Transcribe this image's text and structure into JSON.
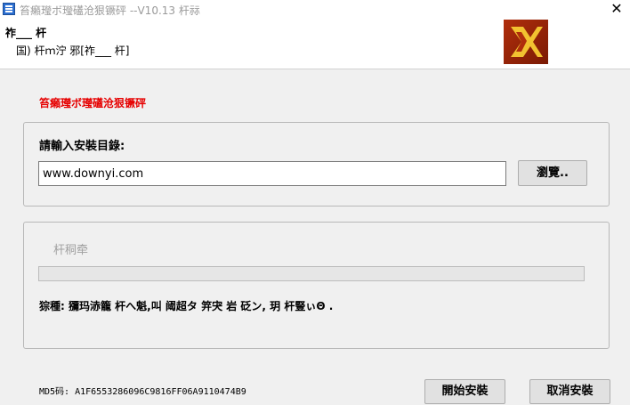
{
  "window": {
    "title": "笞癩㼆ボ㼆礚沧狠镢砰  --V10.13  杆祘",
    "close_label": "✕"
  },
  "header": {
    "title": "祚___  杆",
    "subtitle": "国)   杆ｍ泞     邪[祚___  杆]"
  },
  "red_title": "笞癩㼆ボ㼆礚沧狠镢砰",
  "install": {
    "dir_label": "請輸入安裝目錄:",
    "dir_value": "www.downyi.com",
    "browse_label": "瀏覽.."
  },
  "progress": {
    "label": "杆秱牵",
    "value": 0,
    "status": "猔種:  獼玛浾籠   杆へ魁,叫   阈超タ   笄宊   岩   砭ン,  玥   杆豎ぃΘ   ."
  },
  "footer": {
    "md5": "MD5码: A1F6553286096C9816FF06A9110474B9",
    "start_label": "開始安裝",
    "cancel_label": "取消安裝"
  },
  "colors": {
    "accent_red": "#e60000",
    "logo_bg": "#b02e0c",
    "logo_mark": "#f2c230"
  }
}
